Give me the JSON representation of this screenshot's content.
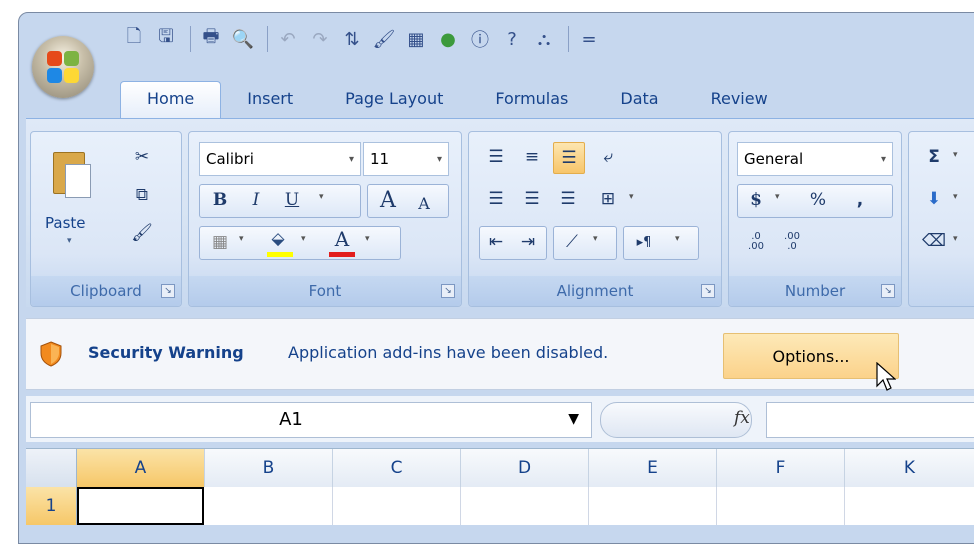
{
  "quick_access": {
    "icons": [
      "new-icon",
      "save-icon",
      "print-icon",
      "print-preview-icon",
      "undo-icon",
      "redo-icon",
      "sort-icon",
      "format-painter-icon",
      "chart-icon",
      "circle-icon",
      "info-icon",
      "help-icon",
      "share-icon"
    ],
    "overflow": "="
  },
  "tabs": [
    {
      "label": "Home"
    },
    {
      "label": "Insert"
    },
    {
      "label": "Page Layout"
    },
    {
      "label": "Formulas"
    },
    {
      "label": "Data"
    },
    {
      "label": "Review"
    }
  ],
  "clipboard": {
    "label": "Clipboard",
    "paste": "Paste"
  },
  "font": {
    "label": "Font",
    "family": "Calibri",
    "size": "11",
    "bold": "B",
    "italic": "I",
    "underline": "U",
    "grow": "A",
    "shrink": "A",
    "font_color": "A"
  },
  "alignment": {
    "label": "Alignment"
  },
  "number": {
    "label": "Number",
    "format": "General",
    "currency": "$",
    "percent": "%",
    "comma": ",",
    "inc_decimal": ".0\n.00",
    "dec_decimal": ".00\n.0"
  },
  "editing": {
    "sum": "Σ"
  },
  "security": {
    "title": "Security Warning",
    "message": "Application add-ins have been disabled.",
    "options": "Options..."
  },
  "formula_bar": {
    "name_box": "A1",
    "fx": "fx"
  },
  "grid": {
    "columns": [
      "A",
      "B",
      "C",
      "D",
      "E",
      "F",
      "K"
    ],
    "rows": [
      "1"
    ]
  },
  "colors": {
    "accent": "#15428b",
    "highlight": "#fbd28a",
    "ribbon": "#dbe6f6"
  }
}
